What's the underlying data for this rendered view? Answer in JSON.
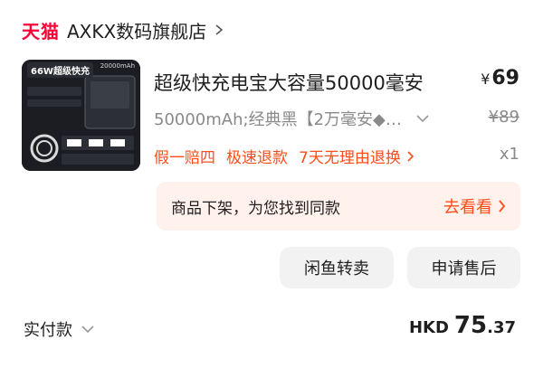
{
  "store": {
    "logo": "天猫",
    "name": "AXKX数码旗舰店"
  },
  "product": {
    "title": "超级快充电宝大容量50000毫安",
    "price_symbol": "¥",
    "price": "69",
    "sku": "50000mAh;经典黑【2万毫安◆…",
    "original_price": "¥89",
    "services": [
      "假一赔四",
      "极速退款",
      "7天无理由退换"
    ],
    "quantity": "x1",
    "image_badge": "66W超级快充",
    "image_capacity": "20000mAh"
  },
  "notice": {
    "text": "商品下架，为您找到同款",
    "link": "去看看"
  },
  "actions": {
    "xianyu": "闲鱼转卖",
    "after_sale": "申请售后"
  },
  "payment": {
    "label": "实付款",
    "currency": "HKD",
    "amount_int": "75",
    "amount_dec": ".37"
  },
  "colors": {
    "brand_red": "#ff0036",
    "accent_orange": "#ff4d1a",
    "notice_bg": "#fff1ec",
    "button_bg": "#f2f2f2"
  }
}
